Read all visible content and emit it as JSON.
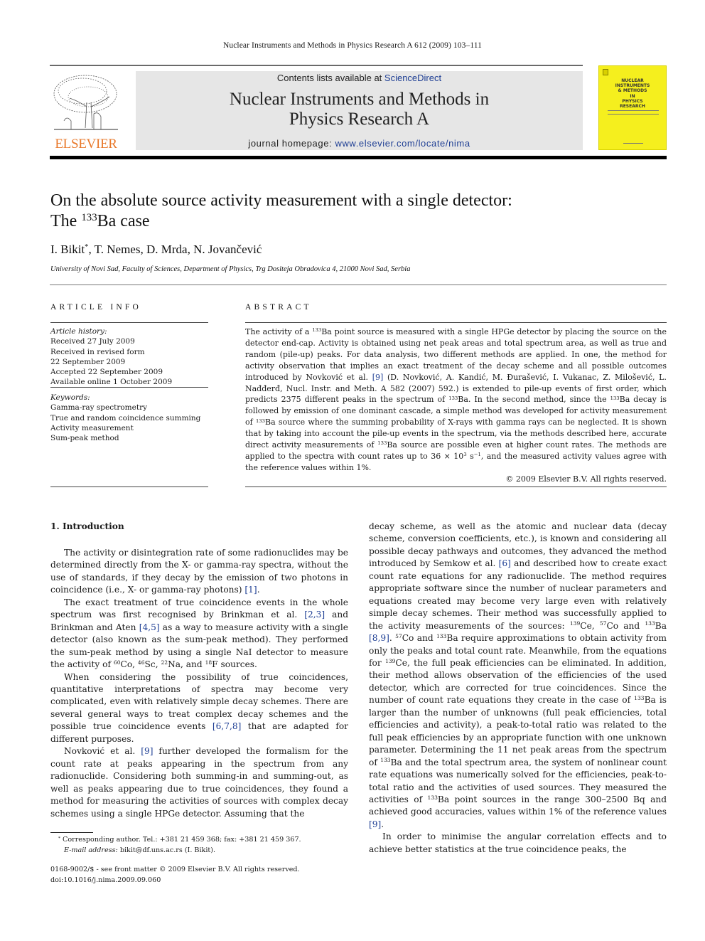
{
  "running_head": "Nuclear Instruments and Methods in Physics Research A 612 (2009) 103–111",
  "masthead": {
    "publisher_logo_text": "ELSEVIER",
    "contents_prefix": "Contents lists available at ",
    "contents_link": "ScienceDirect",
    "journal_title_line1": "Nuclear Instruments and Methods in",
    "journal_title_line2": "Physics Research A",
    "homepage_prefix": "journal homepage: ",
    "homepage_link": "www.elsevier.com/locate/nima",
    "cover_title": [
      "NUCLEAR",
      "INSTRUMENTS",
      "& METHODS",
      "IN",
      "PHYSICS",
      "RESEARCH"
    ],
    "cover_color": "#f5ef1e",
    "logo_color": "#e8782a",
    "link_color": "#1f3f94"
  },
  "article": {
    "title_line1": "On the absolute source activity measurement with a single detector:",
    "title_line2_pre": "The ",
    "title_line2_sup": "133",
    "title_line2_post": "Ba case",
    "authors": [
      {
        "name": "I. Bikit",
        "mark": "*"
      },
      {
        "name": "T. Nemes"
      },
      {
        "name": "D. Mrda"
      },
      {
        "name": "N. Jovančević"
      }
    ],
    "affiliation": "University of Novi Sad, Faculty of Sciences, Department of Physics, Trg Dositeja Obradovica 4, 21000 Novi Sad, Serbia"
  },
  "article_info": {
    "heading": "ARTICLE INFO",
    "history_label": "Article history:",
    "history": [
      "Received 27 July 2009",
      "Received in revised form",
      "22 September 2009",
      "Accepted 22 September 2009",
      "Available online 1 October 2009"
    ],
    "keywords_label": "Keywords:",
    "keywords": [
      "Gamma-ray spectrometry",
      "True and random coincidence summing",
      "Activity measurement",
      "Sum-peak method"
    ]
  },
  "abstract": {
    "heading": "ABSTRACT",
    "seg": [
      "The activity of a ",
      "133",
      "Ba point source is measured with a single HPGe detector by placing the source on the detector end-cap. Activity is obtained using net peak areas and total spectrum area, as well as true and random (pile-up) peaks. For data analysis, two different methods are applied. In one, the method for activity observation that implies an exact treatment of the decay scheme and all possible outcomes introduced by Novković et al. ",
      "[9]",
      " (D. Novković, A. Kandić, M. Đurašević, I. Vukanac, Z. Milošević, L. Nađđerđ, Nucl. Instr. and Meth. A 582 (2007) 592.) is extended to pile-up events of first order, which predicts 2375 different peaks in the spectrum of ",
      "133",
      "Ba. In the second method, since the ",
      "133",
      "Ba decay is followed by emission of one dominant cascade, a simple method was developed for activity measurement of ",
      "133",
      "Ba source where the summing probability of X-rays with gamma rays can be neglected. It is shown that by taking into account the pile-up events in the spectrum, via the methods described here, accurate direct activity measurements of ",
      "133",
      "Ba source are possible even at higher count rates. The methods are applied to the spectra with count rates up to 36 × 10",
      "3",
      " s",
      "−1",
      ", and the measured activity values agree with the reference values within 1%."
    ],
    "copyright": "© 2009 Elsevier B.V. All rights reserved."
  },
  "introduction": {
    "heading": "1.  Introduction",
    "p1": [
      "The activity or disintegration rate of some radionuclides may be determined directly from the X- or gamma-ray spectra, without the use of standards, if they decay by the emission of two photons in coincidence (i.e., X- or gamma-ray photons) ",
      "[1]",
      "."
    ],
    "p2": [
      "The exact treatment of true coincidence events in the whole spectrum was first recognised by Brinkman et al. ",
      "[2,3]",
      " and Brinkman and Aten ",
      "[4,5]",
      " as a way to measure activity with a single detector (also known as the sum-peak method). They performed the sum-peak method by using a single NaI detector to measure the activity of ",
      "60",
      "Co, ",
      "46",
      "Sc, ",
      "22",
      "Na, and ",
      "18",
      "F sources."
    ],
    "p3": [
      "When considering the possibility of true coincidences, quantitative interpretations of spectra may become very complicated, even with relatively simple decay schemes. There are several general ways to treat complex decay schemes and the possible true coincidence events ",
      "[6,7,8]",
      " that are adapted for different purposes."
    ],
    "p4": [
      "Novković et al. ",
      "[9]",
      " further developed the formalism for the count rate at peaks appearing in the spectrum from any radionuclide. Considering both summing-in and summing-out, as well as peaks appearing due to true coincidences, they found a method for measuring the activities of sources with complex decay schemes using a single HPGe detector. Assuming that the"
    ],
    "r1": [
      "decay scheme, as well as the atomic and nuclear data (decay scheme, conversion coefficients, etc.), is known and considering all possible decay pathways and outcomes, they advanced the method introduced by Semkow et al. ",
      "[6]",
      " and described how to create exact count rate equations for any radionuclide. The method requires appropriate software since the number of nuclear parameters and equations created may become very large even with relatively simple decay schemes. Their method was successfully applied to the activity measurements of the sources: ",
      "139",
      "Ce, ",
      "57",
      "Co and ",
      "133",
      "Ba ",
      "[8,9]",
      ". ",
      "57",
      "Co and ",
      "133",
      "Ba require approximations to obtain activity from only the peaks and total count rate. Meanwhile, from the equations for ",
      "139",
      "Ce, the full peak efficiencies can be eliminated. In addition, their method allows observation of the efficiencies of the used detector, which are corrected for true coincidences. Since the number of count rate equations they create in the case of ",
      "133",
      "Ba is larger than the number of unknowns (full peak efficiencies, total efficiencies and activity), a peak-to-total ratio was related to the full peak efficiencies by an appropriate function with one unknown parameter. Determining the 11 net peak areas from the spectrum of ",
      "133",
      "Ba and the total spectrum area, the system of nonlinear count rate equations was numerically solved for the efficiencies, peak-to-total ratio and the activities of used sources. They measured the activities of ",
      "133",
      "Ba point sources in the range 300–2500 Bq and achieved good accuracies, values within 1% of the reference values ",
      "[9]",
      "."
    ],
    "r2": "In order to minimise the angular correlation effects and to achieve better statistics at the true coincidence peaks, the"
  },
  "footnote": {
    "mark": "*",
    "corresponding": " Corresponding author. Tel.: +381 21 459 368; fax: +381 21 459 367.",
    "email_label": "E-mail address:",
    "email": " bikit@df.uns.ac.rs (I. Bikit)."
  },
  "front_matter": {
    "issn_line": "0168-9002/$ - see front matter © 2009 Elsevier B.V. All rights reserved.",
    "doi": "doi:10.1016/j.nima.2009.09.060"
  }
}
